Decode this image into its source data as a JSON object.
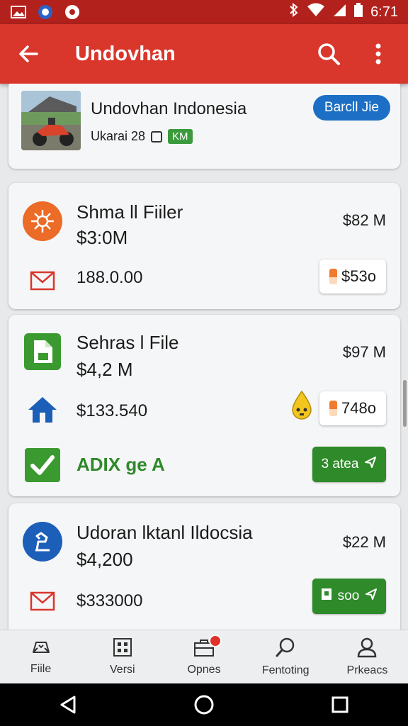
{
  "status_bar": {
    "time": "6:71"
  },
  "app_bar": {
    "title": "Undovhan"
  },
  "header_card": {
    "title": "Undovhan Indonesia",
    "subtitle": "Ukarai 28",
    "tag": "KM",
    "pill_label": "Barcll Jie"
  },
  "cards": [
    {
      "name": "Shma ll Fiiler",
      "amount": "$3:0M",
      "value": "$82 M",
      "secondary_amount": "188.0.00",
      "chip_label": "$53o"
    },
    {
      "name": "Sehras l File",
      "amount": "$4,2 M",
      "value": "$97 M",
      "secondary_amount": "$133.540",
      "chip_label": "748o",
      "status_text": "ADIX ge A",
      "action_label": "3 atea"
    },
    {
      "name": "Udoran lktanl Ildocsia",
      "amount": "$4,200",
      "value": "$22 M",
      "secondary_amount": "$333000",
      "action_label": "soo"
    }
  ],
  "bottom_nav": [
    {
      "label": "Fiile",
      "icon": "gamepad-icon"
    },
    {
      "label": "Versi",
      "icon": "qr-code-icon"
    },
    {
      "label": "Opnes",
      "icon": "briefcase-icon"
    },
    {
      "label": "Fentoting",
      "icon": "search-icon"
    },
    {
      "label": "Prkeacs",
      "icon": "person-icon"
    }
  ],
  "colors": {
    "primary": "#d9362c",
    "status_bar": "#b3211c",
    "accent_blue": "#1c6fc4",
    "accent_green": "#2f8a2a",
    "accent_orange": "#f07b2f"
  }
}
